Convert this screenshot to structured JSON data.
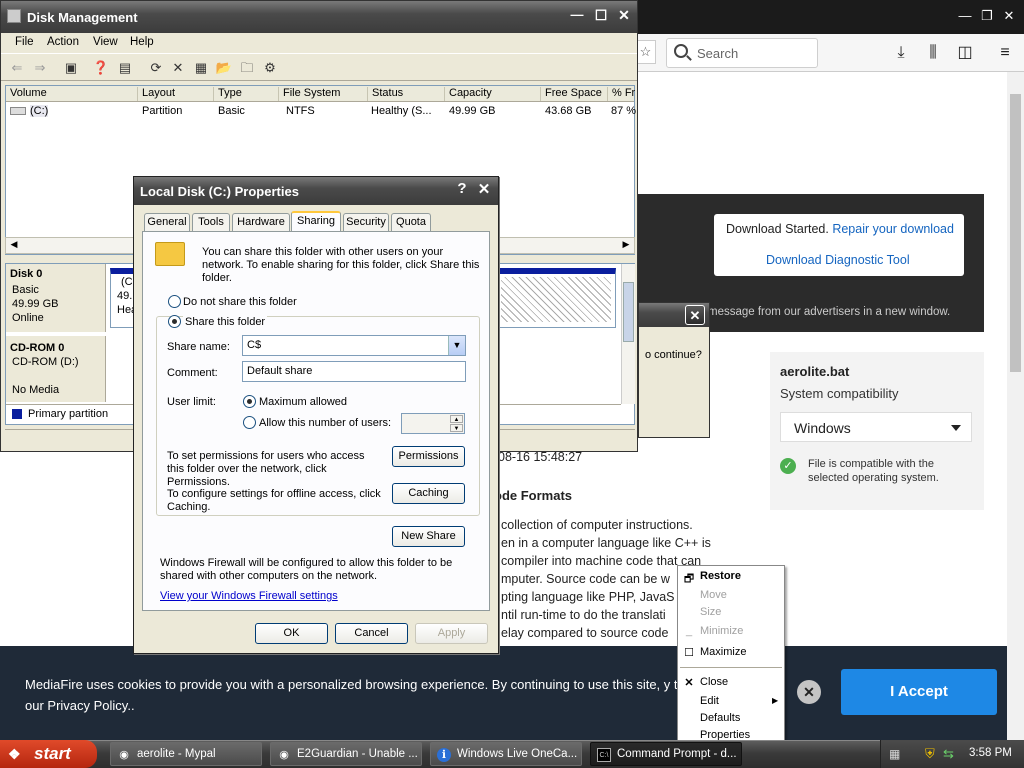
{
  "browser": {
    "search_placeholder": "Search",
    "download_started": "Download Started.",
    "repair_link": "Repair your download",
    "diag_link": "Download Diagnostic Tool",
    "advertisers_msg": "message from our advertisers in a new window.",
    "file": {
      "name": "aerolite.bat",
      "compat_label": "System compatibility",
      "os_value": "Windows",
      "compat_ok": "File is compatible with the selected operating system."
    },
    "article": {
      "date": "08-16 15:48:27",
      "heading": "ode Formats",
      "lines": [
        "collection of computer instructions.",
        "en in a computer language like C++ is",
        "compiler into machine code that can",
        "mputer. Source code can be w",
        "pting language like PHP, JavaS",
        "ntil run-time to do the translati",
        "elay compared to source code"
      ]
    },
    "cookie": {
      "text": "MediaFire uses cookies to provide you with a personalized browsing experience. By continuing to use this site, y to our Privacy Policy..",
      "accept": "I Accept"
    },
    "continue_q": "o continue?"
  },
  "disk_mgmt": {
    "title": "Disk Management",
    "menu": [
      "File",
      "Action",
      "View",
      "Help"
    ],
    "columns": [
      "Volume",
      "Layout",
      "Type",
      "File System",
      "Status",
      "Capacity",
      "Free Space",
      "% Fr"
    ],
    "rows": [
      [
        "(C:)",
        "Partition",
        "Basic",
        "NTFS",
        "Healthy (S...",
        "49.99 GB",
        "43.68 GB",
        "87 %"
      ]
    ],
    "disk0": {
      "name": "Disk 0",
      "type": "Basic",
      "size": "49.99 GB",
      "state": "Online",
      "part_label": "(C",
      "part_size": "49.",
      "part_status": "Hea"
    },
    "cdrom": {
      "name": "CD-ROM 0",
      "drive": "CD-ROM (D:)",
      "media": "No Media"
    },
    "legend": "Primary partition"
  },
  "props": {
    "title": "Local Disk (C:) Properties",
    "help_btn": "?",
    "tabs": [
      "General",
      "Tools",
      "Hardware",
      "Sharing",
      "Security",
      "Quota"
    ],
    "intro": "You can share this folder with other users on your network.  To enable sharing for this folder, click Share this folder.",
    "no_share": "Do not share this folder",
    "share": "Share this folder",
    "share_name_label": "Share name:",
    "share_name": "C$",
    "comment_label": "Comment:",
    "comment": "Default share",
    "user_limit_label": "User limit:",
    "max_allowed": "Maximum allowed",
    "allow_number": "Allow this number of users:",
    "perm_text": "To set permissions for users who access this folder over the network, click Permissions.",
    "perm_btn": "Permissions",
    "cache_text": "To configure settings for offline access, click Caching.",
    "cache_btn": "Caching",
    "new_share": "New Share",
    "firewall_text": "Windows Firewall will be configured to allow this folder to be shared with other computers on the network.",
    "firewall_link": "View your Windows Firewall settings",
    "ok": "OK",
    "cancel": "Cancel",
    "apply": "Apply"
  },
  "context_menu": {
    "items": [
      "Restore",
      "Move",
      "Size",
      "Minimize",
      "Maximize",
      "Close",
      "Edit",
      "Defaults",
      "Properties"
    ]
  },
  "taskbar": {
    "start": "start",
    "tasks": [
      "aerolite - Mypal",
      "E2Guardian - Unable ...",
      "Windows Live OneCa...",
      "Command Prompt - d..."
    ],
    "clock": "3:58 PM"
  }
}
